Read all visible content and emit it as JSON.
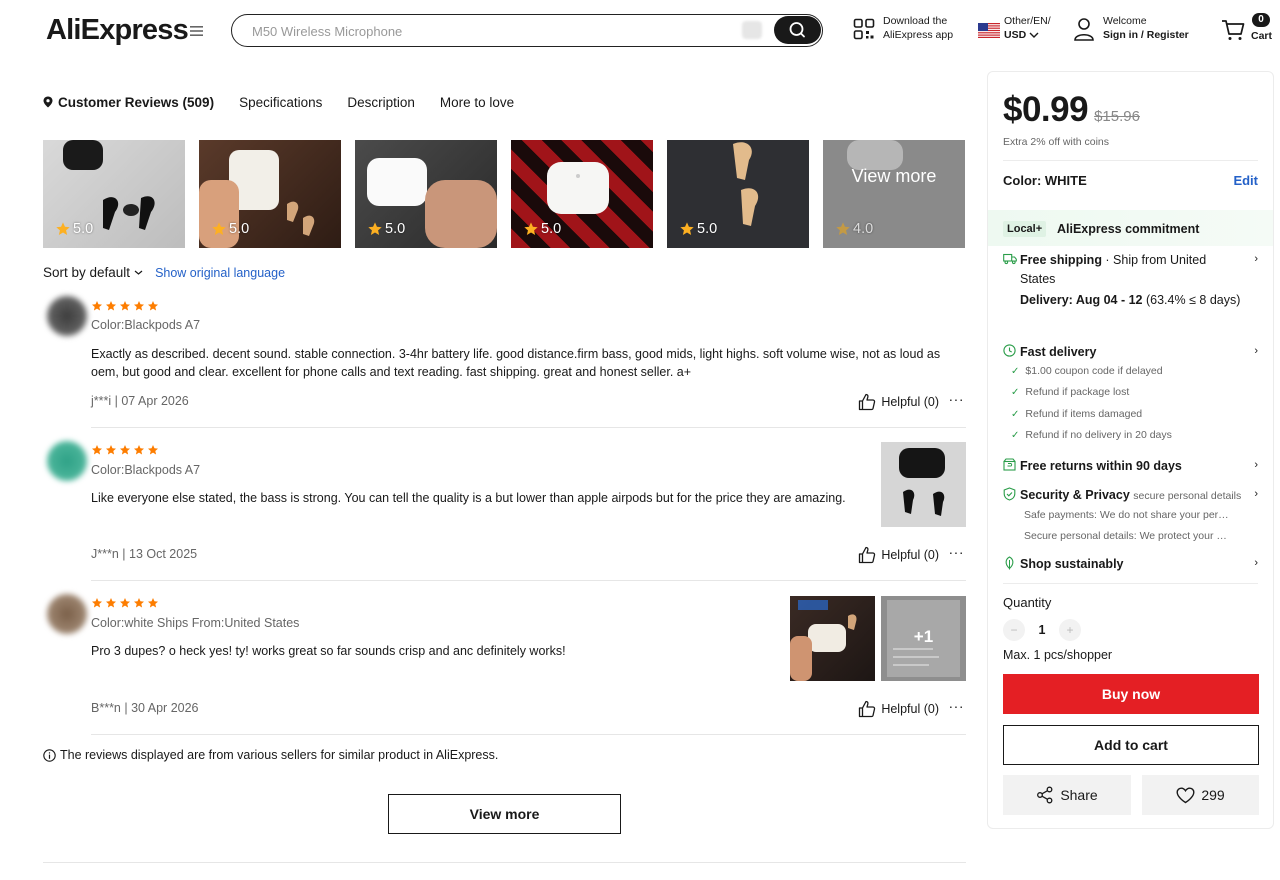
{
  "header": {
    "logo": "AliExpress",
    "search_placeholder": "M50 Wireless Microphone",
    "download_line1": "Download the",
    "download_line2": "AliExpress app",
    "lang_line1": "Other/EN/",
    "lang_line2": "USD",
    "welcome": "Welcome",
    "sign_in": "Sign in / Register",
    "cart_count": "0",
    "cart_label": "Cart"
  },
  "tabs": [
    {
      "label": "Customer Reviews (509)",
      "active": true
    },
    {
      "label": "Specifications"
    },
    {
      "label": "Description"
    },
    {
      "label": "More to love"
    }
  ],
  "thumbnails": [
    {
      "score": "5.0"
    },
    {
      "score": "5.0"
    },
    {
      "score": "5.0"
    },
    {
      "score": "5.0"
    },
    {
      "score": "5.0"
    },
    {
      "score": "4.0",
      "overlay": "View more"
    }
  ],
  "sort": {
    "label": "Sort by default",
    "show_original": "Show original language"
  },
  "reviews": [
    {
      "rating": 5,
      "meta": "Color:Blackpods A7",
      "text": "Exactly as described. decent sound. stable connection. 3-4hr battery life. good distance.firm bass, good mids, light highs. soft volume wise, not as loud as oem, but good and clear. excellent for phone calls and text reading. fast shipping. great and honest seller. a+",
      "author": "j***i | 07 Apr 2026",
      "helpful": "Helpful (0)"
    },
    {
      "rating": 5,
      "meta": "Color:Blackpods A7",
      "text": "Like everyone else stated, the bass is strong. You can tell the quality is a but lower than apple airpods but for the price they are amazing.",
      "author": "J***n | 13 Oct 2025",
      "helpful": "Helpful (0)"
    },
    {
      "rating": 5,
      "meta": "Color:white Ships From:United States",
      "text": "Pro 3 dupes? o heck yes! ty! works great so far sounds crisp and anc definitely works!",
      "author": "B***n | 30 Apr 2026",
      "helpful": "Helpful (0)",
      "extra_images": "+1"
    }
  ],
  "disclaimer": "The reviews displayed are from various sellers for similar product in AliExpress.",
  "view_more": "View more",
  "panel": {
    "price": "$0.99",
    "original_price": "$15.96",
    "coins_note": "Extra 2% off with coins",
    "color_label": "Color: WHITE",
    "edit": "Edit",
    "commit_badge": "Local+",
    "commit_title": "AliExpress commitment",
    "shipping_title": "Free shipping",
    "shipping_from": " · Ship from United States",
    "delivery_label": "Delivery: Aug 04 - 12",
    "delivery_note": " (63.4% ≤ 8 days)",
    "fast_delivery": "Fast delivery",
    "fast_items": [
      "$1.00 coupon code if delayed",
      "Refund if package lost",
      "Refund if items damaged",
      "Refund if no delivery in 20 days"
    ],
    "returns": "Free returns within 90 days",
    "security_title": "Security & Privacy",
    "security_note": "secure personal details",
    "security_lines": [
      "Safe payments: We do not share your personal details with any third parties without your consent.",
      "Secure personal details: We protect your privacy and keep your personal details safe and secure."
    ],
    "sustain": "Shop sustainably",
    "quantity_label": "Quantity",
    "qty_minus": "−",
    "qty_value": "1",
    "qty_plus": "+",
    "max_note": "Max. 1 pcs/shopper",
    "buy_now": "Buy now",
    "add_to_cart": "Add to cart",
    "share": "Share",
    "wishlist_count": "299"
  },
  "colors": {
    "buy_red": "#e41f24",
    "link_blue": "#2461c8",
    "star_orange": "#fd7d00",
    "check_green": "#2a9d49"
  }
}
